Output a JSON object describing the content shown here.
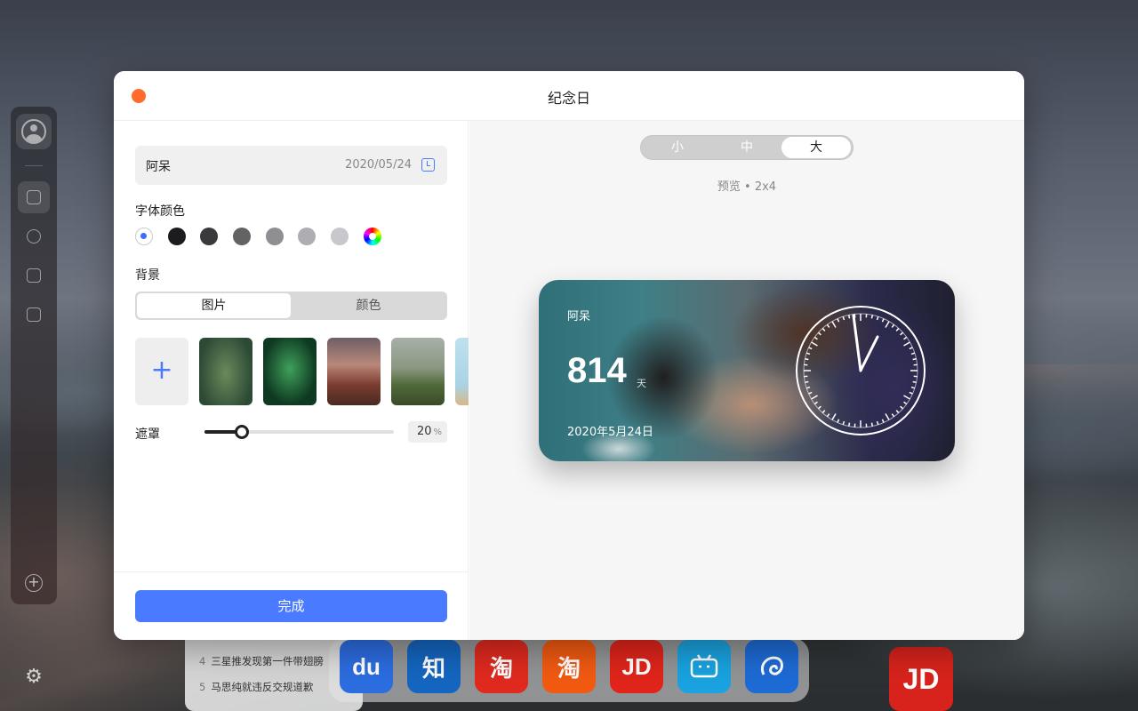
{
  "modal": {
    "title": "纪念日",
    "name": "阿呆",
    "date": "2020/05/24",
    "font_color_label": "字体颜色",
    "font_colors": [
      "#ffffff",
      "#1c1c1e",
      "#3a3a3c",
      "#636366",
      "#8e8e93",
      "#aeaeb2",
      "#c7c7cc"
    ],
    "background_label": "背景",
    "background_tabs": [
      "图片",
      "颜色"
    ],
    "background_selected": "图片",
    "mask_label": "遮罩",
    "mask_value": "20",
    "mask_unit": "%",
    "mask_fraction": 0.2,
    "done_label": "完成"
  },
  "preview": {
    "sizes": [
      "小",
      "中",
      "大"
    ],
    "selected_size": "大",
    "label": "预览 • 2x4",
    "card": {
      "name": "阿呆",
      "days": "814",
      "unit": "天",
      "date": "2020年5月24日"
    }
  },
  "news": [
    {
      "n": "4",
      "text": "三星推发现第一件带翅膀"
    },
    {
      "n": "5",
      "text": "马思纯就违反交规道歉"
    }
  ],
  "dock_apps": [
    {
      "name": "baidu",
      "label": "du",
      "color": "#2c6de0"
    },
    {
      "name": "zhihu",
      "label": "知",
      "color": "#1466c0"
    },
    {
      "name": "taobao",
      "label": "淘",
      "color": "#e02a1f"
    },
    {
      "name": "taobao-orange",
      "label": "淘",
      "color": "#f25a12"
    },
    {
      "name": "jd",
      "label": "JD",
      "color": "#e1251b"
    },
    {
      "name": "bilibili",
      "label": "",
      "color": "#1aa3e0"
    },
    {
      "name": "ctrip",
      "label": "",
      "color": "#1e6bd6"
    }
  ],
  "desktop_app": {
    "name": "jd",
    "label": "JD",
    "color": "#d8231c"
  },
  "icons": {
    "close": "close-dot",
    "calendar": "calendar-icon",
    "add": "plus-icon",
    "settings": "gear-icon"
  }
}
